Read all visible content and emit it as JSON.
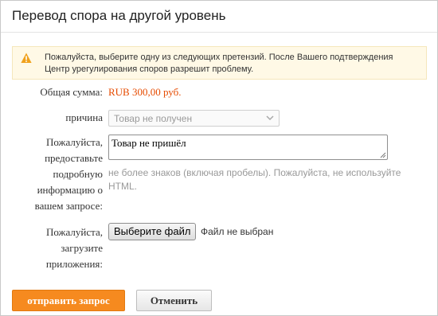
{
  "dialog": {
    "title": "Перевод спора на другой уровень"
  },
  "notice": {
    "icon": "warning-icon",
    "icon_color": "#f0a11b",
    "text": "Пожалуйста, выберите одну из следующих претензий. После Вашего подтверждения Центр урегулирования споров разрешит проблему."
  },
  "form": {
    "total_label": "Общая сумма:",
    "total_value": "RUB 300,00 руб.",
    "reason_label": "причина",
    "reason_selected": "Товар не получен",
    "details_label": "Пожалуйста, предоставьте подробную информацию о вашем запросе:",
    "details_value": "Товар не пришёл",
    "details_hint": "не более знаков (включая пробелы). Пожалуйста, не используйте HTML.",
    "attach_label": "Пожалуйста, загрузите приложения:",
    "attach_button": "Выберите файл",
    "attach_status": "Файл не выбран"
  },
  "actions": {
    "submit_label": "отправить запрос",
    "cancel_label": "Отменить"
  },
  "colors": {
    "accent": "#f68a1f",
    "amount": "#e64b00",
    "notice_bg": "#fff9e6"
  }
}
